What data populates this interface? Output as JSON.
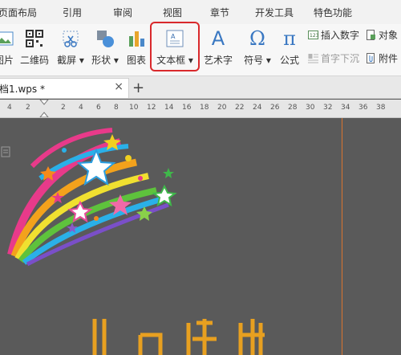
{
  "menu": {
    "items": [
      "页面布局",
      "引用",
      "审阅",
      "视图",
      "章节",
      "开发工具",
      "特色功能"
    ]
  },
  "ribbon": {
    "picture_label": "图片",
    "qrcode_label": "二维码",
    "screenshot_label": "截屏",
    "shapes_label": "形状",
    "chart_label": "图表",
    "textbox_label": "文本框",
    "wordart_label": "艺术字",
    "symbol_label": "符号",
    "formula_label": "公式",
    "symbol_glyph": "Ω",
    "formula_glyph": "π",
    "wordart_glyph": "A",
    "insert_number": "插入数字",
    "object": "对象",
    "dropcap": "首字下沉",
    "attachment": "附件"
  },
  "tabs": {
    "doc_name": "档1.wps *",
    "close": "×",
    "add": "+"
  },
  "ruler": {
    "marks": [
      "4",
      "2",
      "2",
      "4",
      "6",
      "8",
      "10",
      "12",
      "14",
      "16",
      "18",
      "20",
      "22",
      "24",
      "26",
      "28",
      "30",
      "32",
      "34",
      "36",
      "38"
    ]
  },
  "colors": {
    "accent_red": "#d9292c",
    "margin": "#d9732e"
  }
}
